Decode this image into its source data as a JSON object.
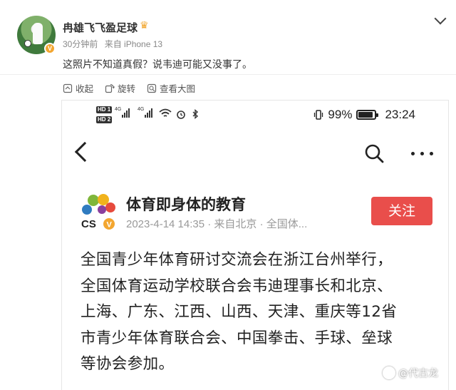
{
  "post": {
    "username": "冉雄飞飞盈足球",
    "time": "30分钟前",
    "source": "来自 iPhone 13",
    "text": "这照片不知道真假？说韦迪可能又没事了。",
    "actions": [
      {
        "label": "收起",
        "icon": "collapse-icon"
      },
      {
        "label": "旋转",
        "icon": "rotate-icon"
      },
      {
        "label": "查看大图",
        "icon": "zoom-image-icon"
      }
    ],
    "badge": "V"
  },
  "screenshot": {
    "status": {
      "hd1": "HD 1",
      "hd2": "HD 2",
      "sig1": "4G",
      "sig2": "4G",
      "battery_pct": "99%",
      "time": "23:24"
    },
    "account": {
      "name": "体育即身体的教育",
      "meta": "2023-4-14 14:35 · 来自北京 · 全国体...",
      "logo_text": "CS",
      "follow_label": "关注"
    },
    "article_lines": [
      "全国青少年体育研讨交流会在浙江台州举行，",
      "全国体育运动学校联合会韦迪理事长和北京、",
      "上海、广东、江西、山西、天津、重庆等12省",
      "市青少年体育联合会、中国拳击、手球、垒球",
      "等协会参加。"
    ],
    "watermark": "@代古龙"
  },
  "colors": {
    "follow_button": "#e94e4b",
    "badge": "#f3a630"
  }
}
